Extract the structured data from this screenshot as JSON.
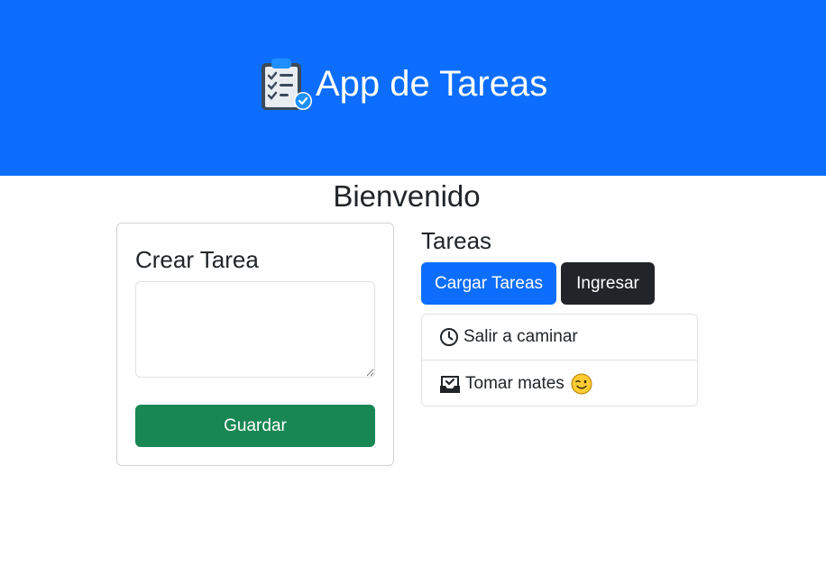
{
  "header": {
    "title": "App de Tareas",
    "icon": "clipboard-check-icon",
    "background_color": "#0d6efd"
  },
  "welcome": "Bienvenido",
  "create_card": {
    "title": "Crear Tarea",
    "textarea_value": "",
    "save_label": "Guardar",
    "save_color": "#198754"
  },
  "tasks_panel": {
    "title": "Tareas",
    "load_label": "Cargar Tareas",
    "load_color": "#0d6efd",
    "login_label": "Ingresar",
    "login_color": "#212529",
    "items": [
      {
        "icon": "clock-icon",
        "label": "Salir a caminar"
      },
      {
        "icon": "inbox-check-icon",
        "label": "Tomar mates",
        "emoji": "winking-face-emoji"
      }
    ]
  }
}
